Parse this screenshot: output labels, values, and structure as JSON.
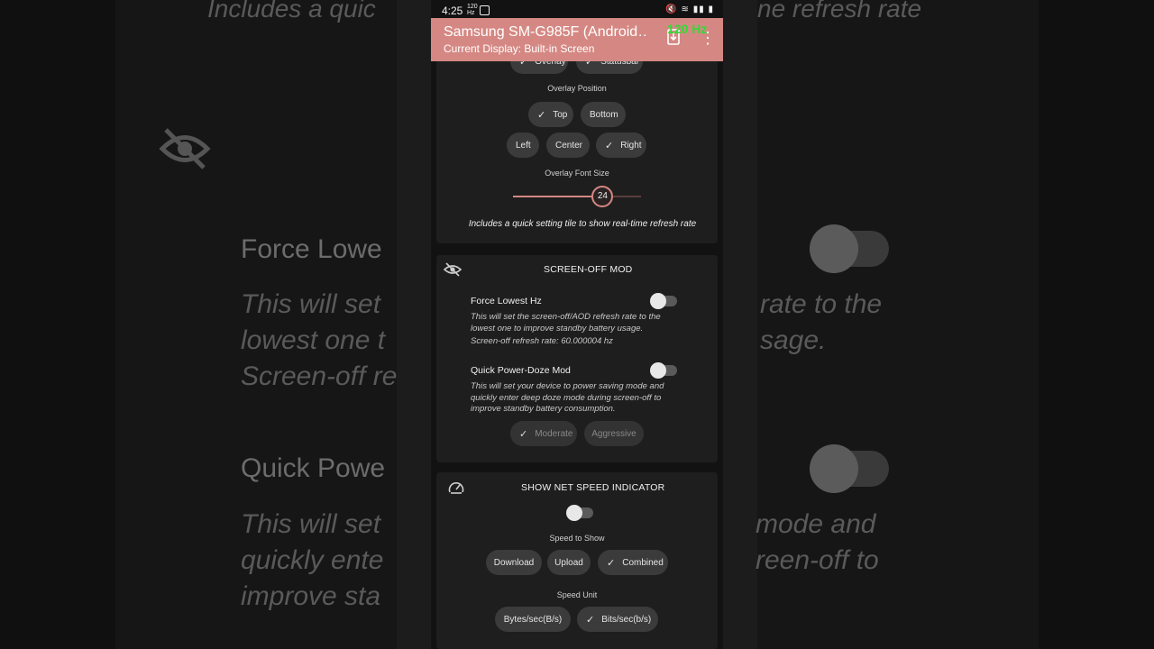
{
  "background": {
    "top_left": "Includes a quic",
    "top_right": "ne refresh rate",
    "heading1": "Force Lowe",
    "desc1": [
      "This will set",
      "lowest one t",
      "Screen-off re"
    ],
    "right1": [
      "rate to the",
      "sage."
    ],
    "heading2": "Quick Powe",
    "desc2": [
      "This will set",
      "quickly ente",
      "improve sta"
    ],
    "right2": [
      "mode and",
      "reen-off to"
    ]
  },
  "statusbar": {
    "time": "4:25",
    "mini_top": "120",
    "mini_bottom": "Hz",
    "icons": "🔇 ≋ ▮▮ ▮"
  },
  "appbar": {
    "title": "Samsung SM-G985F (Android…",
    "subtitle": "Current Display: Built-in Screen",
    "overlay_hz": "120 Hz",
    "menu_icon": "⋮",
    "accent": "#d58883"
  },
  "overlay_card": {
    "top_chips": [
      "Overlay",
      "Statusbar"
    ],
    "position_label": "Overlay Position",
    "vertical_options": [
      "Top",
      "Bottom"
    ],
    "vertical_selected": "Top",
    "horizontal_options": [
      "Left",
      "Center",
      "Right"
    ],
    "horizontal_selected": "Right",
    "font_size_label": "Overlay Font Size",
    "font_size_value": "24",
    "font_size_level": 0.7,
    "note": "Includes a quick setting tile to show real-time refresh rate"
  },
  "screen_off": {
    "title": "SCREEN-OFF MOD",
    "icon": "eye-off-icon",
    "force_lowest": {
      "title": "Force Lowest Hz",
      "desc": "This will set the screen-off/AOD refresh rate to the lowest one to improve standby battery usage.",
      "rate": "Screen-off refresh rate: 60.000004 hz",
      "enabled": false
    },
    "quick_doze": {
      "title": "Quick Power-Doze Mod",
      "desc": "This will set your device to power saving mode and quickly enter deep doze mode during screen-off to improve standby battery consumption.",
      "enabled": false
    },
    "doze_options": [
      "Moderate",
      "Aggressive"
    ],
    "doze_selected": "Moderate"
  },
  "net_speed": {
    "title": "SHOW NET SPEED INDICATOR",
    "icon": "speedometer-icon",
    "enabled": false,
    "speed_label": "Speed to Show",
    "speed_options": [
      "Download",
      "Upload",
      "Combined"
    ],
    "speed_selected": "Combined",
    "unit_label": "Speed Unit",
    "unit_options": [
      "Bytes/sec(B/s)",
      "Bits/sec(b/s)"
    ],
    "unit_selected": "Bits/sec(b/s)"
  }
}
